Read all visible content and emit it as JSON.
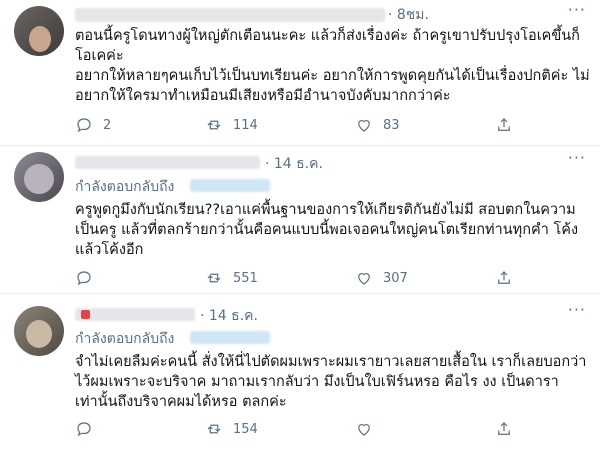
{
  "tweets": [
    {
      "time": "· 8ชม.",
      "text": "ตอนนี้ครูโดนทางผู้ใหญ่ตักเตือนนะคะ แล้วก็ส่งเรื่องค่ะ ถ้าครูเขาปรับปรุงโอเคขึ้นก็โอเคค่ะ\nอยากให้หลายๆคนเก็บไว้เป็นบทเรียนค่ะ อยากให้การพูดคุยกันได้เป็นเรื่องปกติค่ะ ไม่อยากให้ใครมาทำเหมือนมีเสียงหรือมีอำนาจบังคับมากกว่าค่ะ",
      "replies": "2",
      "retweets": "114",
      "likes": "83"
    },
    {
      "time": "· 14 ธ.ค.",
      "reply_label": "กำลังตอบกลับถึง",
      "text": "ครูพูดกูมึงกับนักเรียน??เอาแค่พื้นฐานของการให้เกียรติกันยังไม่มี สอบตกในความเป็นครู แล้วที่ตลกร้ายกว่านั้นคือคนแบบนี้พอเจอคนใหญ่คนโตเรียกท่านทุกคำ โค้งแล้วโค้งอีก",
      "replies": "",
      "retweets": "551",
      "likes": "307"
    },
    {
      "time": "· 14 ธ.ค.",
      "reply_label": "กำลังตอบกลับถึง",
      "text": "จำไม่เคยลืมค่ะคนนี้ สั่งให้นี่ไปตัดผมเพราะผมเรายาวเลยสายเสื้อใน เราก็เลยบอกว่าไว้ผมเพราะจะบริจาค มาถามเรากลับว่า มึงเป็นใบเฟิร์นหรอ คือไร งง เป็นดาราเท่านั้นถึงบริจาคผมได้หรอ ตลกค่ะ",
      "replies": "",
      "retweets": "154",
      "likes": ""
    }
  ],
  "icons": {
    "reply": "reply-icon",
    "retweet": "retweet-icon",
    "like": "like-icon",
    "share": "share-icon",
    "more": "more-options-icon"
  },
  "colors": {
    "text": "#0f1419",
    "muted": "#5b7083",
    "link": "#1da1f2",
    "divider": "#e6ecf0"
  }
}
